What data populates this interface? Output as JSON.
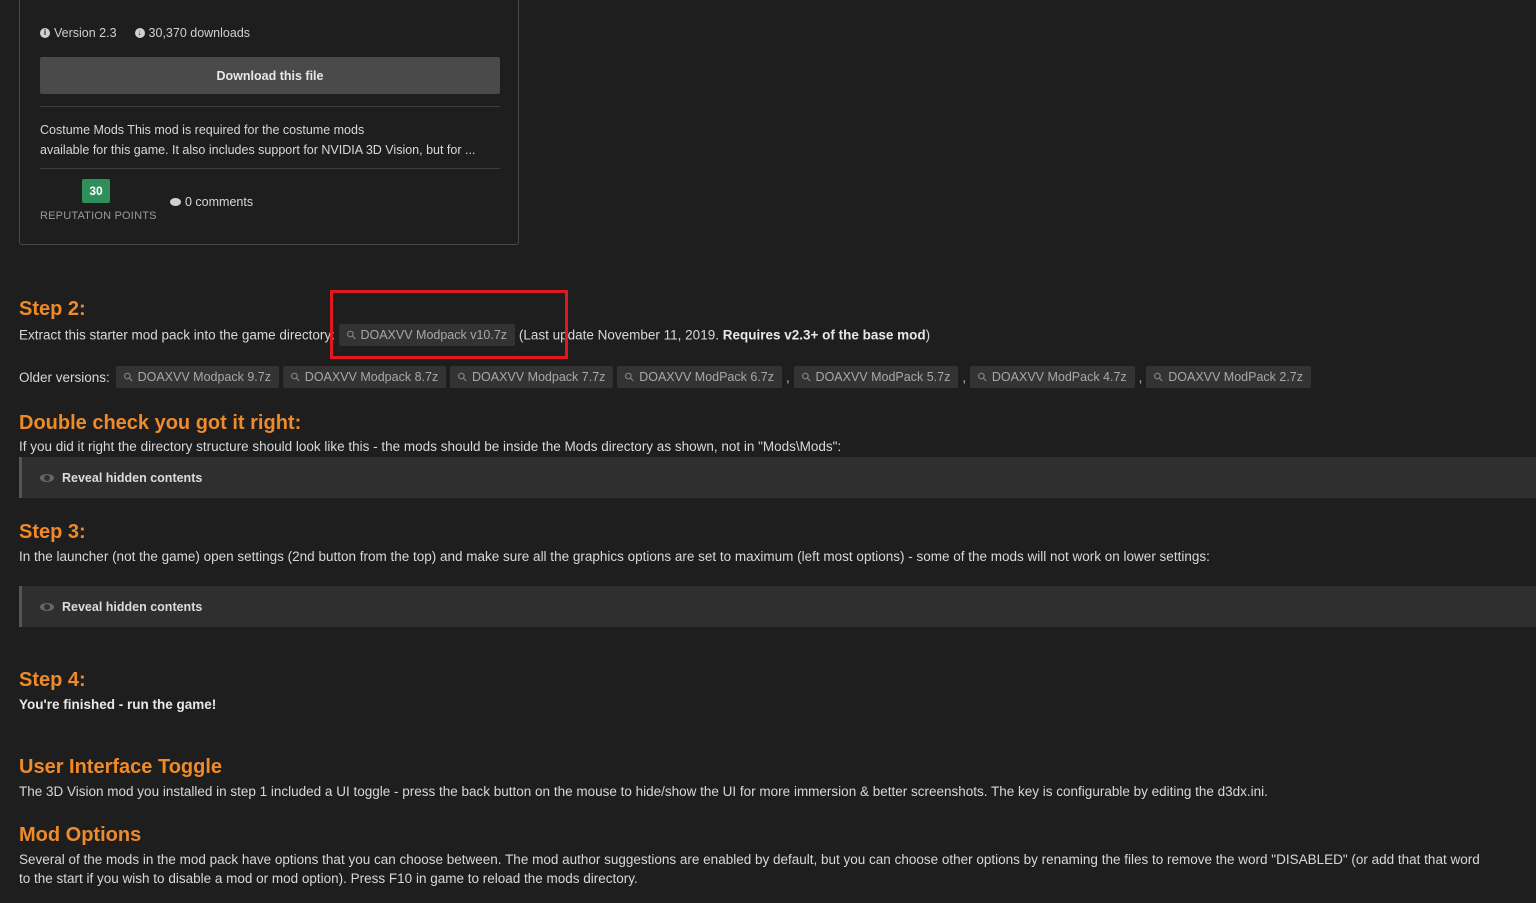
{
  "file_card": {
    "version": "Version 2.3",
    "downloads": "30,370 downloads",
    "download_button": "Download this file",
    "description_line1": "Costume Mods This mod is required for the costume mods",
    "description_line2": "available for this game.   It also includes support for NVIDIA 3D Vision, but for ...",
    "reputation_value": "30",
    "reputation_label": "REPUTATION POINTS",
    "comments": "0 comments"
  },
  "step2": {
    "heading": "Step 2:",
    "text_before": "Extract this starter mod pack into the game directory:",
    "attachment": "DOAXVV Modpack v10.7z",
    "text_after": "(Last update November 11, 2019. ",
    "text_bold": "Requires v2.3+ of the base mod",
    "text_end": ")"
  },
  "older": {
    "label": "Older versions:",
    "items": [
      "DOAXVV Modpack 9.7z",
      "DOAXVV Modpack 8.7z",
      "DOAXVV Modpack 7.7z",
      "DOAXVV ModPack 6.7z",
      "DOAXVV ModPack 5.7z",
      "DOAXVV ModPack 4.7z",
      "DOAXVV ModPack 2.7z"
    ]
  },
  "double_check": {
    "heading": "Double check you got it right:",
    "text": "If you did it right the directory structure should look like this - the mods should be inside the Mods directory as shown, not in \"Mods\\Mods\":",
    "reveal": "Reveal hidden contents"
  },
  "step3": {
    "heading": "Step 3:",
    "text": "In the launcher (not the game) open settings (2nd button from the top) and make sure all the graphics options are set to maximum (left most options) - some of the mods will not work on lower settings:",
    "reveal": "Reveal hidden contents"
  },
  "step4": {
    "heading": "Step 4:",
    "text": "You're finished - run the game!"
  },
  "ui_toggle": {
    "heading": "User Interface Toggle",
    "text": "The 3D Vision mod you installed in step 1 included a UI toggle - press the back button on the mouse to hide/show the UI for more immersion & better screenshots. The key is configurable by editing the d3dx.ini."
  },
  "mod_options": {
    "heading": "Mod Options",
    "text_line1": "Several of the mods in the mod pack have options that you can choose between. The mod author suggestions are enabled by default, but you can choose other options by renaming the files to remove the word \"DISABLED\" (or add that that word",
    "text_line2": "to the start if you wish to disable a mod or mod option). Press F10 in game to reload the mods directory."
  },
  "colors": {
    "heading": "#ee8a2a",
    "background": "#1e1e1e",
    "highlight": "#e0191f",
    "reputation": "#2f8f5a"
  }
}
